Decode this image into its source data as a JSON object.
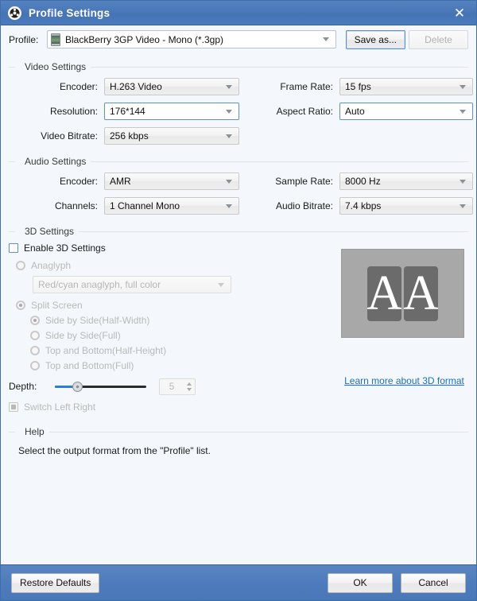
{
  "window": {
    "title": "Profile Settings",
    "icon": "gear-icon",
    "close_label": "✕",
    "titlebar_color": "#4a78b8",
    "body_color": "#f4f8fc"
  },
  "profile": {
    "label": "Profile:",
    "value": "BlackBerry 3GP Video - Mono (*.3gp)",
    "device_icon": "device-thumbnail-icon",
    "save_as_label": "Save as...",
    "delete_label": "Delete"
  },
  "video_settings": {
    "title": "Video Settings",
    "fields": [
      {
        "label": "Encoder:",
        "value": "H.263 Video",
        "state": "normal"
      },
      {
        "label": "Frame Rate:",
        "value": "15 fps",
        "state": "normal"
      },
      {
        "label": "Resolution:",
        "value": "176*144",
        "state": "editable"
      },
      {
        "label": "Aspect Ratio:",
        "value": "Auto",
        "state": "editable"
      },
      {
        "label": "Video Bitrate:",
        "value": "256 kbps",
        "state": "normal"
      }
    ]
  },
  "audio_settings": {
    "title": "Audio Settings",
    "fields": [
      {
        "label": "Encoder:",
        "value": "AMR",
        "state": "normal"
      },
      {
        "label": "Sample Rate:",
        "value": "8000 Hz",
        "state": "normal"
      },
      {
        "label": "Channels:",
        "value": "1 Channel Mono",
        "state": "normal"
      },
      {
        "label": "Audio Bitrate:",
        "value": "7.4 kbps",
        "state": "normal"
      }
    ]
  },
  "threed_settings": {
    "title": "3D Settings",
    "enable_label": "Enable 3D Settings",
    "enable_checked": false,
    "anaglyph_label": "Anaglyph",
    "anaglyph_selected": false,
    "anaglyph_value": "Red/cyan anaglyph, full color",
    "split_screen_label": "Split Screen",
    "split_screen_selected": true,
    "split_options": [
      {
        "label": "Side by Side(Half-Width)",
        "selected": true
      },
      {
        "label": "Side by Side(Full)",
        "selected": false
      },
      {
        "label": "Top and Bottom(Half-Height)",
        "selected": false
      },
      {
        "label": "Top and Bottom(Full)",
        "selected": false
      }
    ],
    "depth_label": "Depth:",
    "depth_value": "5",
    "switch_lr_label": "Switch Left Right",
    "learn_more_label": "Learn more about 3D format",
    "link_color": "#1a6fc4",
    "preview_letters": [
      "A",
      "A"
    ]
  },
  "help": {
    "title": "Help",
    "text": "Select the output format from the \"Profile\" list."
  },
  "footer": {
    "restore_label": "Restore Defaults",
    "ok_label": "OK",
    "cancel_label": "Cancel"
  }
}
